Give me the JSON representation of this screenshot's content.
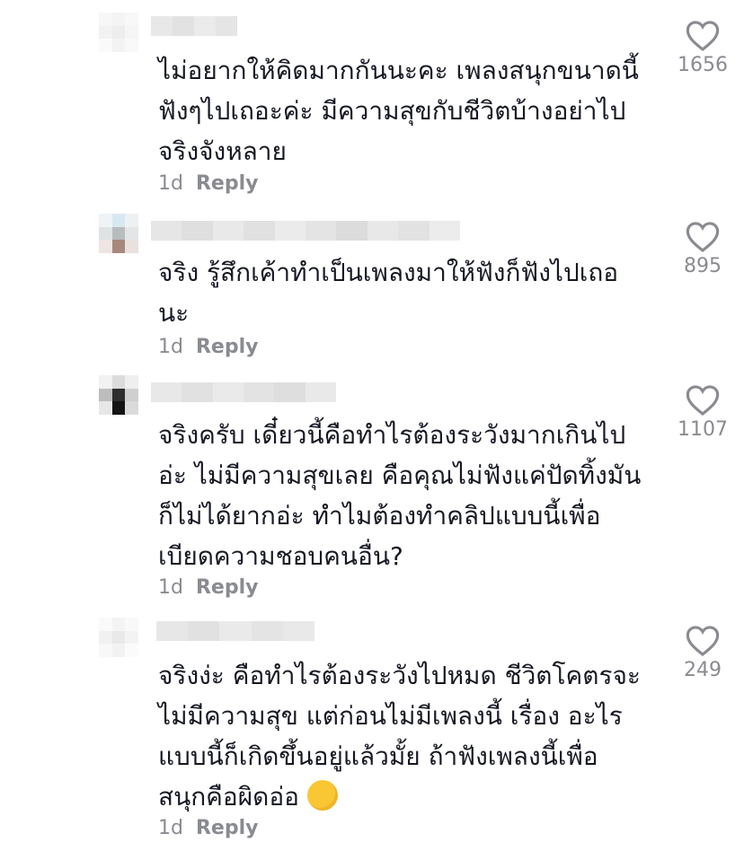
{
  "comments": [
    {
      "text": "ไม่อยากให้คิดมากกันนะคะ เพลงสนุกขนาดนี้\nฟังๆไปเถอะค่ะ มีความสุขกับชีวิตบ้างอย่าไป\nจริงจังหลาย",
      "time": "1d",
      "reply": "Reply",
      "likes": "1656",
      "emoji": ""
    },
    {
      "text": "จริง รู้สึกเค้าทำเป็นเพลงมาให้ฟังก็ฟังไปเถอ\nนะ",
      "time": "1d",
      "reply": "Reply",
      "likes": "895",
      "emoji": ""
    },
    {
      "text": "จริงครับ เดี๋ยวนี้คือทำไรต้องระวังมากเกินไป\nอ่ะ ไม่มีความสุขเลย คือคุณไม่ฟังแค่ปัดทิ้งมัน\nก็ไม่ได้ยากอ่ะ ทำไมต้องทำคลิปแบบนี้เพื่อ\nเบียดความชอบคนอื่น?",
      "time": "1d",
      "reply": "Reply",
      "likes": "1107",
      "emoji": ""
    },
    {
      "text": "จริงง่ะ คือทำไรต้องระวังไปหมด ชีวิตโคตรจะ\nไม่มีความสุข แต่ก่อนไม่มีเพลงนี้ เรื่อง อะไร\nแบบนี้ก็เกิดขึ้นอยู่แล้วมั้ย ถ้าฟังเพลงนี้เพื่อ\nสนุกคือผิดอ่อ",
      "time": "1d",
      "reply": "Reply",
      "likes": "249",
      "emoji": "relieved-face"
    }
  ],
  "colors": {
    "text": "#161823",
    "meta": "#8a8b91",
    "heart": "#8a8b91"
  },
  "icons": {
    "like": "heart-outline-icon",
    "emoji": "relieved-face-emoji"
  }
}
